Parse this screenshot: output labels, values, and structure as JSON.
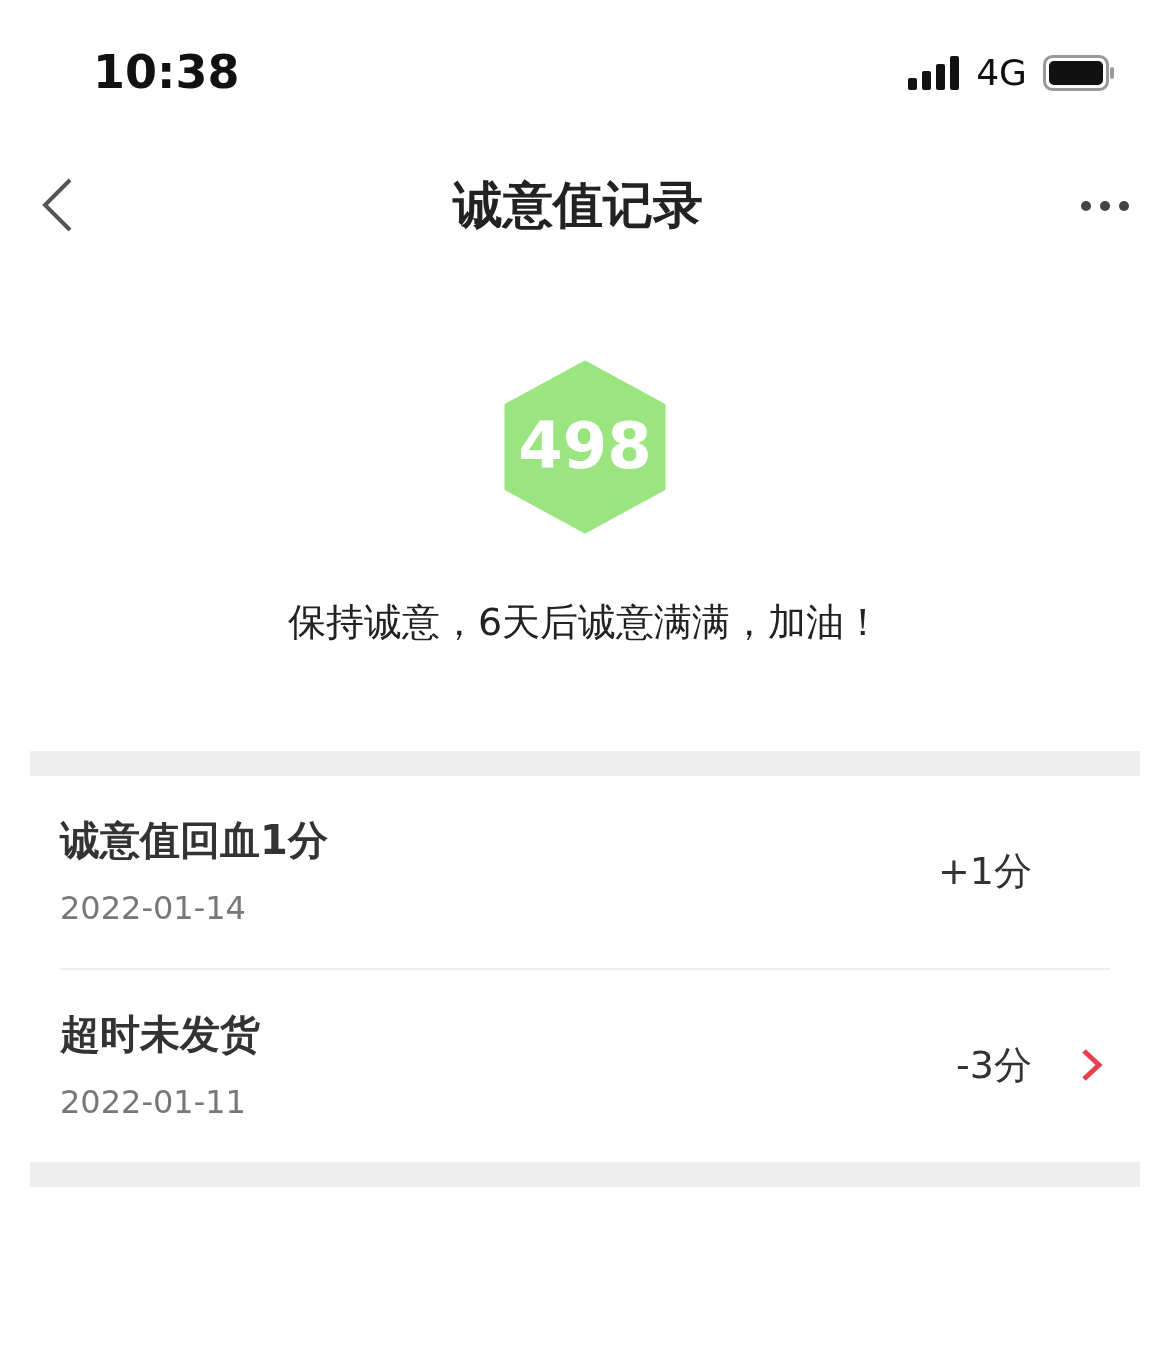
{
  "status_bar": {
    "time": "10:38",
    "network": "4G"
  },
  "nav": {
    "title": "诚意值记录"
  },
  "score": {
    "value": "498",
    "message": "保持诚意，6天后诚意满满，加油！"
  },
  "records": [
    {
      "title": "诚意值回血1分",
      "date": "2022-01-14",
      "change": "+1分",
      "has_detail": false
    },
    {
      "title": "超时未发货",
      "date": "2022-01-11",
      "change": "-3分",
      "has_detail": true
    }
  ]
}
